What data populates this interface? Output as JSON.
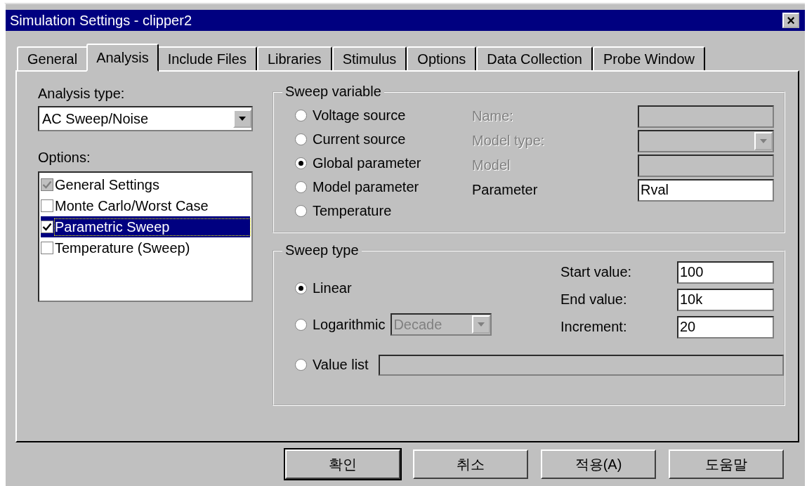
{
  "window": {
    "title": "Simulation Settings - clipper2",
    "close": "×"
  },
  "tabs": [
    {
      "label": "General",
      "selected": false
    },
    {
      "label": "Analysis",
      "selected": true
    },
    {
      "label": "Include Files",
      "selected": false
    },
    {
      "label": "Libraries",
      "selected": false
    },
    {
      "label": "Stimulus",
      "selected": false
    },
    {
      "label": "Options",
      "selected": false
    },
    {
      "label": "Data Collection",
      "selected": false
    },
    {
      "label": "Probe Window",
      "selected": false
    }
  ],
  "analysis_type": {
    "label": "Analysis type:",
    "value": "AC Sweep/Noise"
  },
  "options": {
    "label": "Options:",
    "items": [
      {
        "label": "General Settings",
        "checked": true,
        "disabled": true,
        "selected": false
      },
      {
        "label": "Monte Carlo/Worst Case",
        "checked": false,
        "disabled": false,
        "selected": false
      },
      {
        "label": "Parametric Sweep",
        "checked": true,
        "disabled": false,
        "selected": true
      },
      {
        "label": "Temperature (Sweep)",
        "checked": false,
        "disabled": false,
        "selected": false
      }
    ]
  },
  "sweep_variable": {
    "title": "Sweep variable",
    "choices": [
      {
        "label": "Voltage source",
        "selected": false
      },
      {
        "label": "Current source",
        "selected": false
      },
      {
        "label": "Global parameter",
        "selected": true
      },
      {
        "label": "Model parameter",
        "selected": false
      },
      {
        "label": "Temperature",
        "selected": false
      }
    ],
    "fields": [
      {
        "label": "Name:",
        "kind": "text",
        "disabled": true
      },
      {
        "label": "Model type:",
        "kind": "dropdown",
        "disabled": true
      },
      {
        "label": "Model",
        "kind": "text",
        "disabled": true
      },
      {
        "label": "Parameter",
        "kind": "text",
        "disabled": false,
        "value": "Rval"
      }
    ]
  },
  "sweep_type": {
    "title": "Sweep type",
    "choices": [
      {
        "label": "Linear",
        "selected": true,
        "kind": "plain"
      },
      {
        "label": "Logarithmic",
        "selected": false,
        "kind": "dropdown",
        "dropdown": {
          "value": "Decade",
          "disabled": true
        }
      },
      {
        "label": "Value list",
        "selected": false,
        "kind": "field",
        "field": {
          "disabled": true
        }
      }
    ],
    "fields": [
      {
        "label": "Start value:",
        "value": "100"
      },
      {
        "label": "End value:",
        "value": "10k"
      },
      {
        "label": "Increment:",
        "value": "20"
      }
    ]
  },
  "buttons": [
    {
      "label": "확인",
      "default": true
    },
    {
      "label": "취소",
      "default": false
    },
    {
      "label": "적용(A)",
      "default": false
    },
    {
      "label": "도움말",
      "default": false
    }
  ]
}
